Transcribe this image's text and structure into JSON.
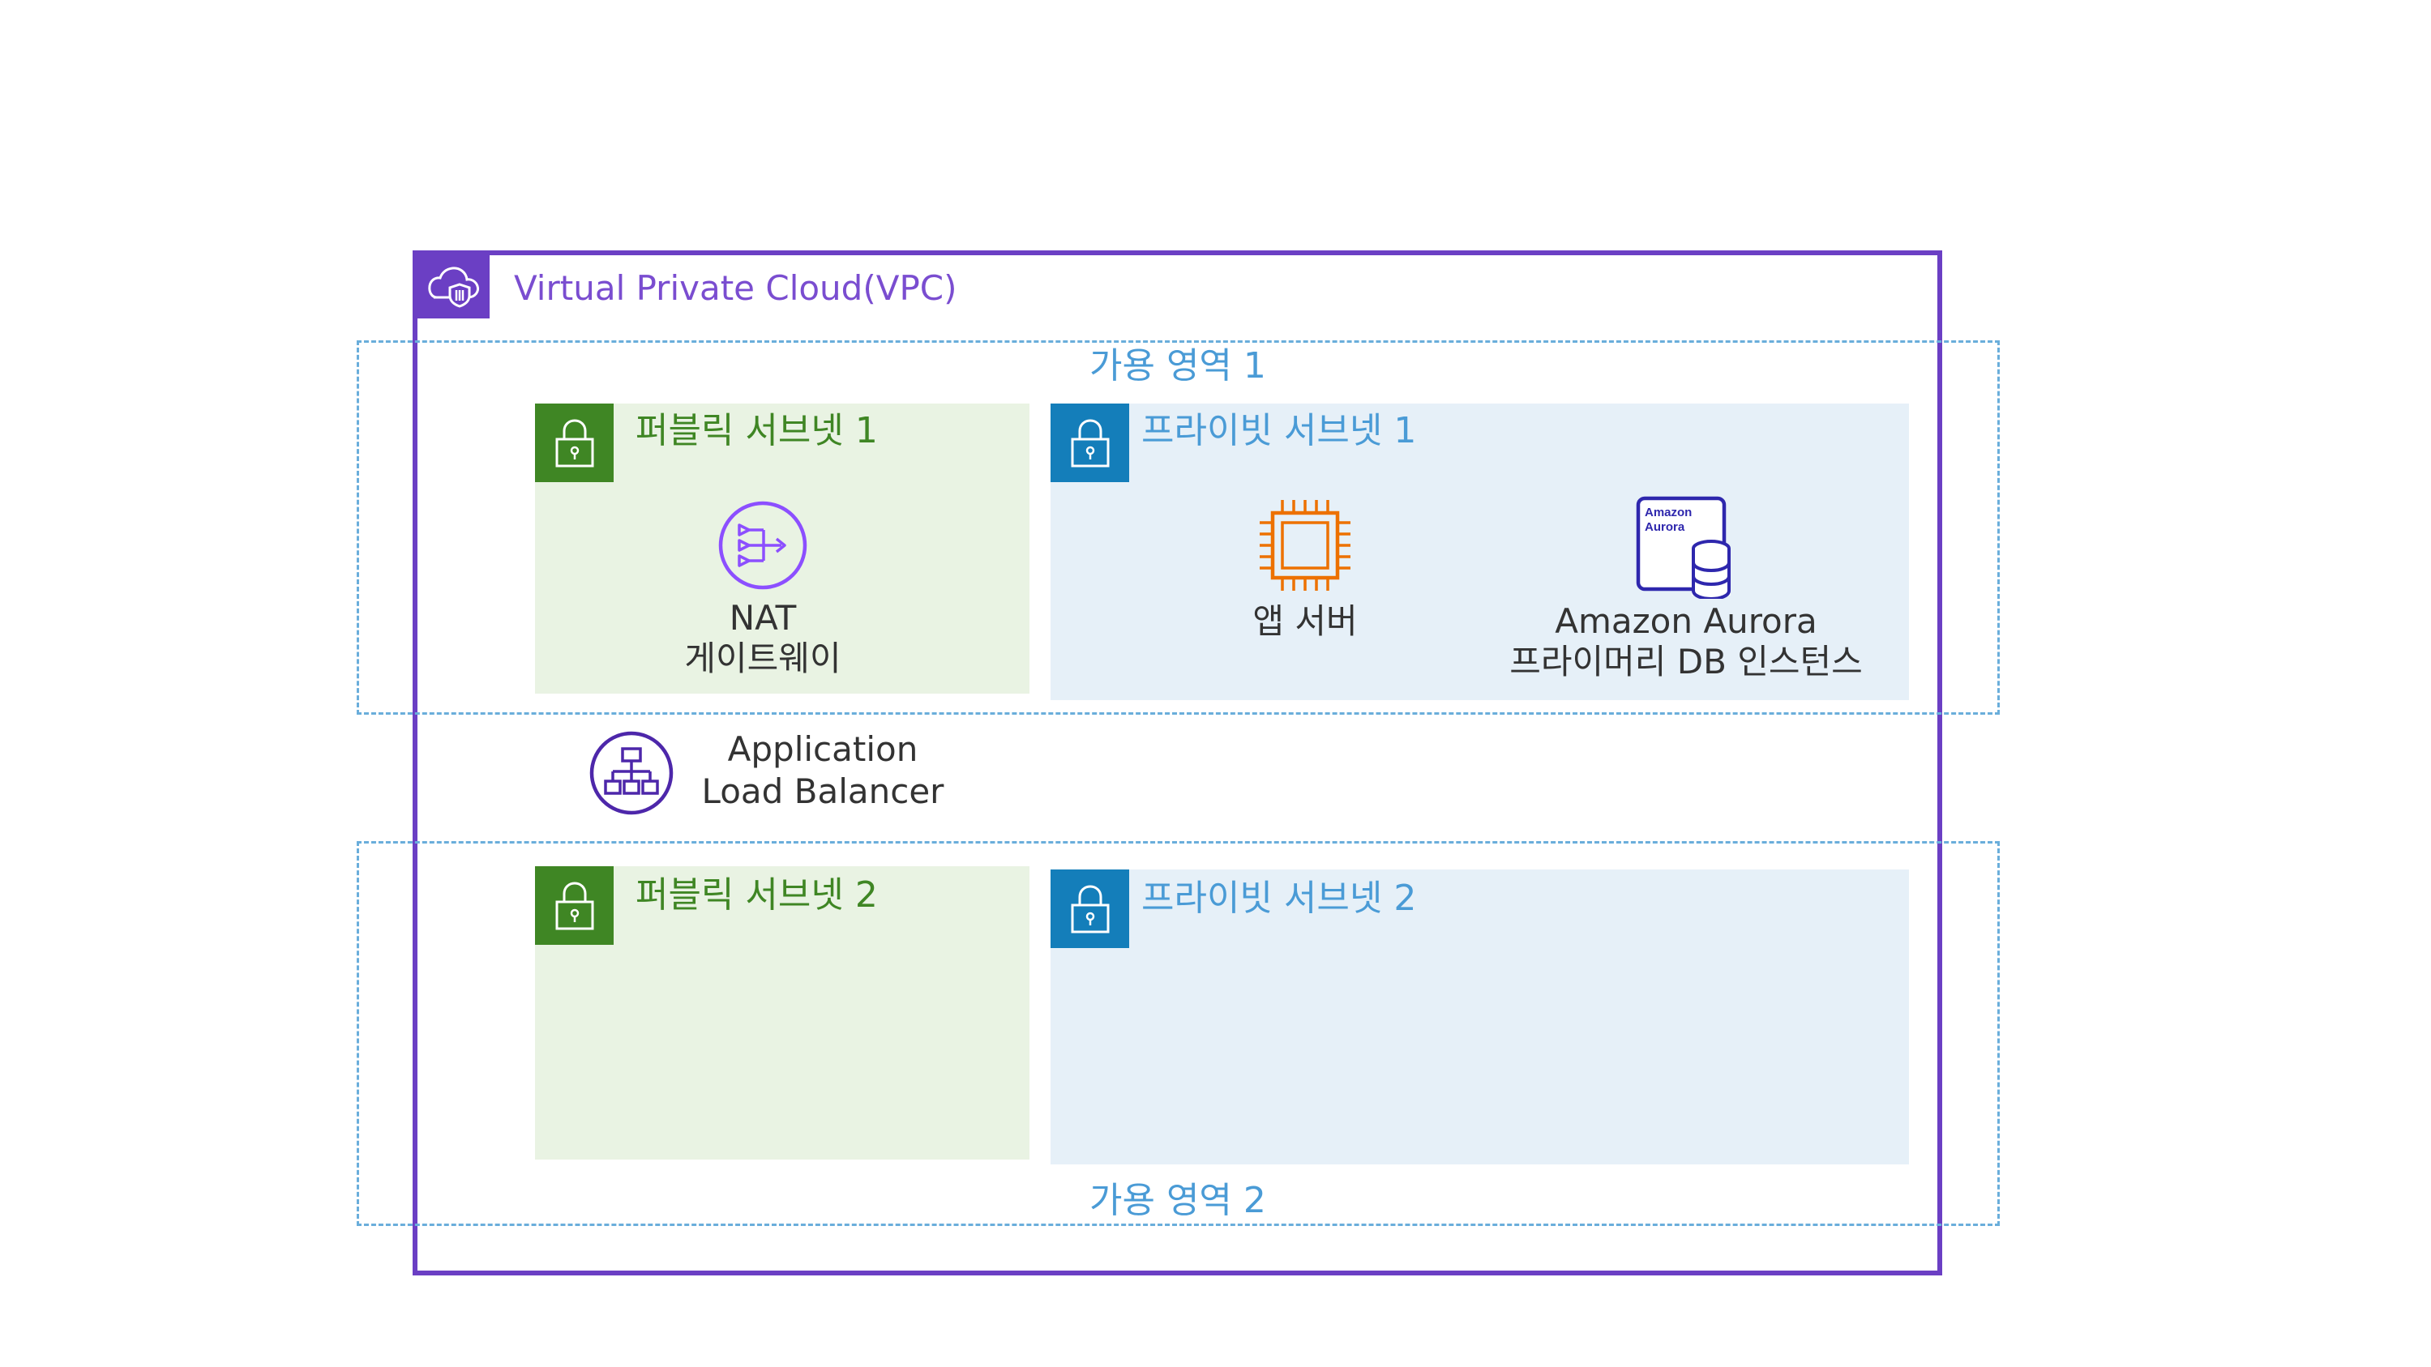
{
  "vpc": {
    "title": "Virtual Private Cloud(VPC)",
    "icon": "vpc-cloud-icon",
    "color": "#6B3FC4"
  },
  "availability_zones": [
    {
      "label": "가용 영역 1"
    },
    {
      "label": "가용 영역 2"
    }
  ],
  "subnets": {
    "public1": {
      "label": "퍼블릭 서브넷 1",
      "color": "#3F8624",
      "fill": "#E9F3E3"
    },
    "private1": {
      "label": "프라이빗 서브넷 1",
      "color": "#147EBA",
      "fill": "#E6F0F8"
    },
    "public2": {
      "label": "퍼블릭 서브넷 2",
      "color": "#3F8624",
      "fill": "#E9F3E3"
    },
    "private2": {
      "label": "프라이빗 서브넷 2",
      "color": "#147EBA",
      "fill": "#E6F0F8"
    }
  },
  "nodes": {
    "nat": {
      "line1": "NAT",
      "line2": "게이트웨이",
      "icon": "nat-gateway-icon"
    },
    "app_server": {
      "label": "앱 서버",
      "icon": "ec2-chip-icon"
    },
    "aurora": {
      "line1": "Amazon Aurora",
      "line2": "프라이머리 DB 인스턴스",
      "icon_text1": "Amazon",
      "icon_text2": "Aurora",
      "icon": "aurora-database-icon"
    },
    "alb": {
      "line1": "Application",
      "line2": "Load Balancer",
      "icon": "load-balancer-icon"
    }
  }
}
